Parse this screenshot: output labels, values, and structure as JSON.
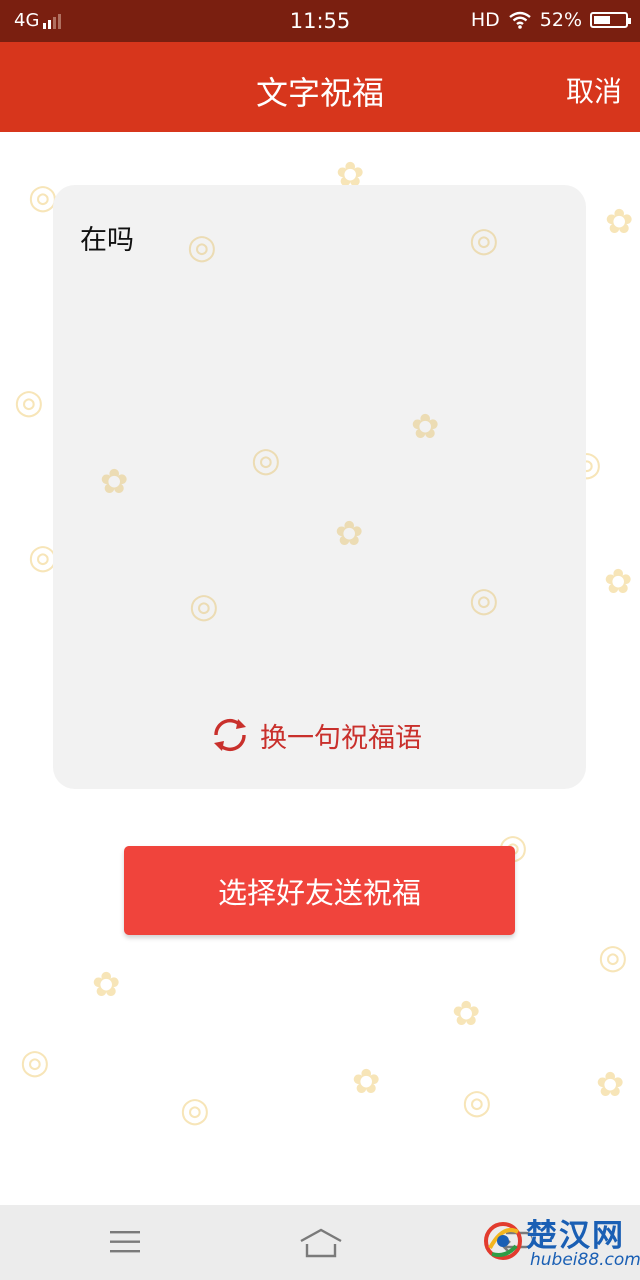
{
  "status_bar": {
    "network": "4G",
    "time": "11:55",
    "hd": "HD",
    "battery": "52%",
    "battery_level": 0.52
  },
  "header": {
    "title": "文字祝福",
    "cancel": "取消"
  },
  "card": {
    "message": "在吗",
    "switch_label": "换一句祝福语"
  },
  "send_button": "选择好友送祝福",
  "watermark": {
    "title": "楚汉网",
    "url": "hubei88.com"
  },
  "colors": {
    "status_bar": "#7a1f10",
    "header": "#d7361c",
    "accent_text": "#c9302c",
    "button": "#f0443c",
    "card": "#f2f2f2",
    "nav_bar": "#ececec"
  },
  "icons": [
    "signal-icon",
    "wifi-icon",
    "battery-icon",
    "refresh-icon",
    "menu-icon",
    "home-icon",
    "back-icon",
    "watermark-logo-icon"
  ]
}
